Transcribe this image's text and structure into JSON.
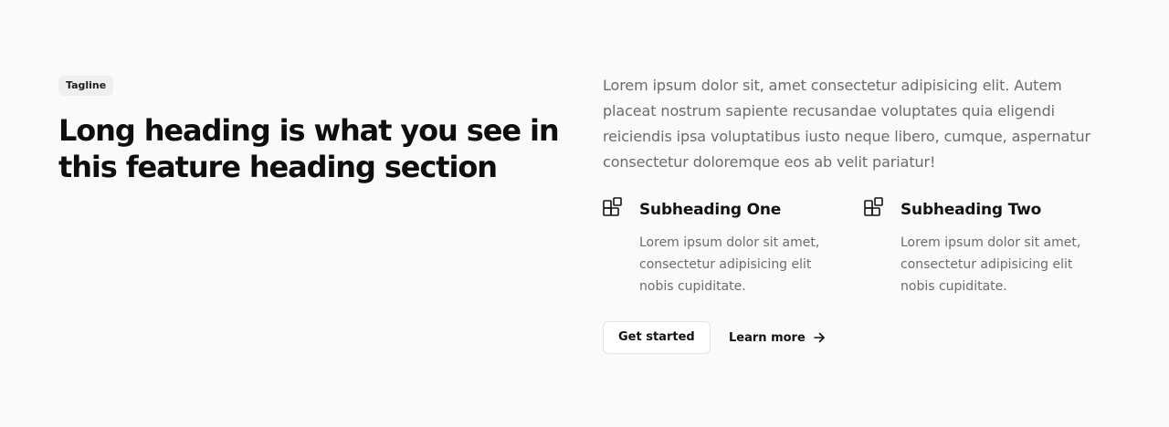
{
  "left": {
    "tagline": "Tagline",
    "heading": "Long heading is what you see in this feature heading section"
  },
  "right": {
    "intro": "Lorem ipsum dolor sit, amet consectetur adipisicing elit. Autem placeat nostrum sapiente recusandae voluptates quia eligendi reiciendis ipsa voluptatibus iusto neque libero, cumque, aspernatur consectetur doloremque eos ab velit pariatur!",
    "features": [
      {
        "icon": "layout-grid-icon",
        "title": "Subheading One",
        "text": "Lorem ipsum dolor sit amet, consectetur adipisicing elit nobis cupiditate."
      },
      {
        "icon": "layout-grid-icon",
        "title": "Subheading Two",
        "text": "Lorem ipsum dolor sit amet, consectetur adipisicing elit nobis cupiditate."
      }
    ],
    "actions": {
      "primary_label": "Get started",
      "secondary_label": "Learn more",
      "secondary_icon": "arrow-right-icon"
    }
  },
  "colors": {
    "background": "#fafafb",
    "text_dark": "#111214",
    "text_muted": "#6a6b71",
    "tagline_bg": "#efeff1",
    "button_border": "#e4e4e8"
  }
}
